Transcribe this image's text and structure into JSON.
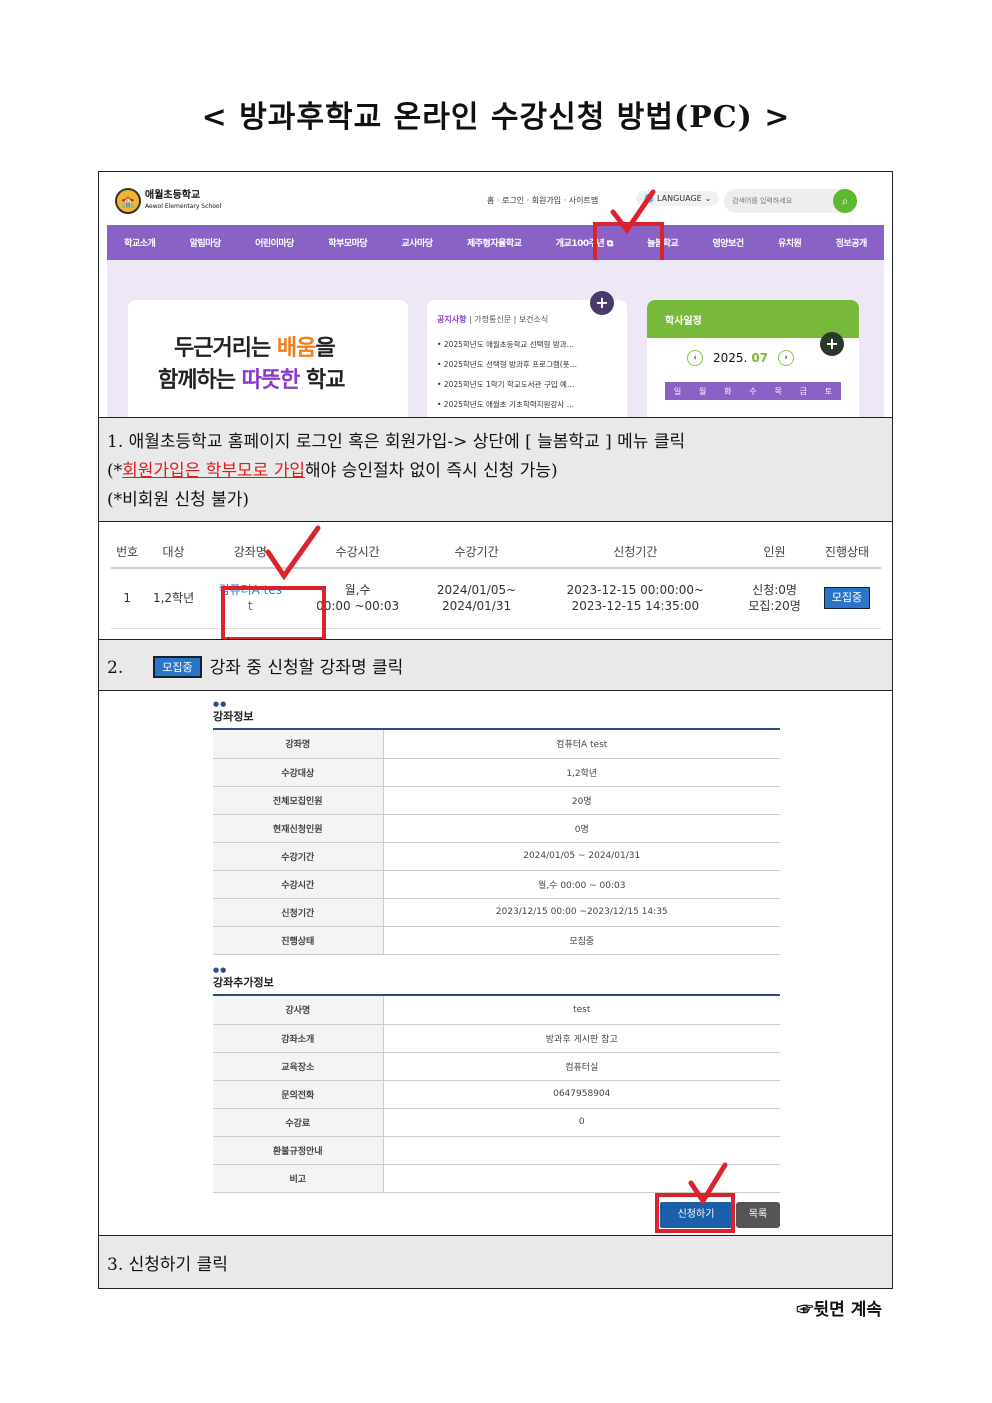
{
  "title": "< 방과후학교 온라인 수강신청 방법(PC) >",
  "homepage": {
    "logo_name": "애월초등학교",
    "logo_sub": "Aewol Elementary School",
    "top_links": "홈 · 로그인 · 회원가입 · 사이트맵",
    "language": "LANGUAGE",
    "search_placeholder": "검색어를 입력하세요",
    "nav": [
      "학교소개",
      "알림마당",
      "어린이마당",
      "학부모마당",
      "교사마당",
      "제주형자율학교",
      "개교100주년 ⧉",
      "늘봄학교",
      "영양보건",
      "유치원",
      "정보공개"
    ],
    "banner_line1_a": "두근거리는 ",
    "banner_line1_b": "배움",
    "banner_line1_c": "을",
    "banner_line2_a": "함께하는 ",
    "banner_line2_b": "따뜻한",
    "banner_line2_c": " 학교",
    "notice_tab_active": "공지사항",
    "notice_tabs_rest": " | 가정통신문 | 보건소식",
    "notices": [
      "• 2025학년도 애월초등학교 선택형 방과…",
      "• 2025학년도 선택형 방과후 프로그램(풋…",
      "• 2025학년도 1학기 학교도서관 구입 예…",
      "• 2025학년도 애월초 기초학력지원강사 …"
    ],
    "calendar_title": "학사일정",
    "calendar_year": "2025.",
    "calendar_month": "07",
    "weekdays": [
      "일",
      "월",
      "화",
      "수",
      "목",
      "금",
      "토"
    ]
  },
  "step1": {
    "line1": "1. 애월초등학교 홈페이지 로그인 혹은 회원가입-> 상단에 [ 늘봄학교 ] 메뉴 클릭",
    "line2_pre": "(*",
    "line2_red": "회원가입은 학부모로 가입",
    "line2_post": "해야 승인절차 없이 즉시 신청 가능)",
    "line3": "(*비회원 신청 불가)"
  },
  "course_table": {
    "headers": [
      "번호",
      "대상",
      "강좌명",
      "수강시간",
      "수강기간",
      "신청기간",
      "인원",
      "진행상태"
    ],
    "row": {
      "no": "1",
      "target": "1,2학년",
      "name_1": "컴퓨터A tes",
      "name_2": "t",
      "time_1": "월,수",
      "time_2": "00:00 ~00:03",
      "period_1": "2024/01/05~",
      "period_2": "2024/01/31",
      "apply_1": "2023-12-15 00:00:00~",
      "apply_2": "2023-12-15 14:35:00",
      "count_1": "신청:0명",
      "count_2": "모집:20명",
      "status": "모집중"
    }
  },
  "step2": {
    "num": "2.",
    "badge": "모집중",
    "text": "강좌 중 신청할 강좌명 클릭"
  },
  "detail": {
    "info_title": "강좌정보",
    "info": [
      {
        "k": "강좌명",
        "v": "컴퓨터A test"
      },
      {
        "k": "수강대상",
        "v": "1,2학년"
      },
      {
        "k": "전체모집인원",
        "v": "20명"
      },
      {
        "k": "현재신청인원",
        "v": "0명"
      },
      {
        "k": "수강기간",
        "v": "2024/01/05 ~ 2024/01/31"
      },
      {
        "k": "수강시간",
        "v": "월,수 00:00 ~ 00:03"
      },
      {
        "k": "신청기간",
        "v": "2023/12/15 00:00 ~2023/12/15 14:35"
      },
      {
        "k": "진행상태",
        "v": "모집중"
      }
    ],
    "extra_title": "강좌추가정보",
    "extra": [
      {
        "k": "강사명",
        "v": "test"
      },
      {
        "k": "강좌소개",
        "v": "방과후 게시판 참고"
      },
      {
        "k": "교육장소",
        "v": "컴퓨터실"
      },
      {
        "k": "문의전화",
        "v": "0647958904"
      },
      {
        "k": "수강료",
        "v": "0"
      },
      {
        "k": "환불규정안내",
        "v": ""
      },
      {
        "k": "비고",
        "v": ""
      }
    ],
    "apply_button": "신청하기",
    "list_button": "목록"
  },
  "step3": {
    "text": "3. 신청하기 클릭"
  },
  "footer": "☞뒷면 계속",
  "colors": {
    "nav": "#8a62c6",
    "highlight": "#d9232d",
    "badge": "#2a74c9",
    "calendar": "#78b83a"
  }
}
